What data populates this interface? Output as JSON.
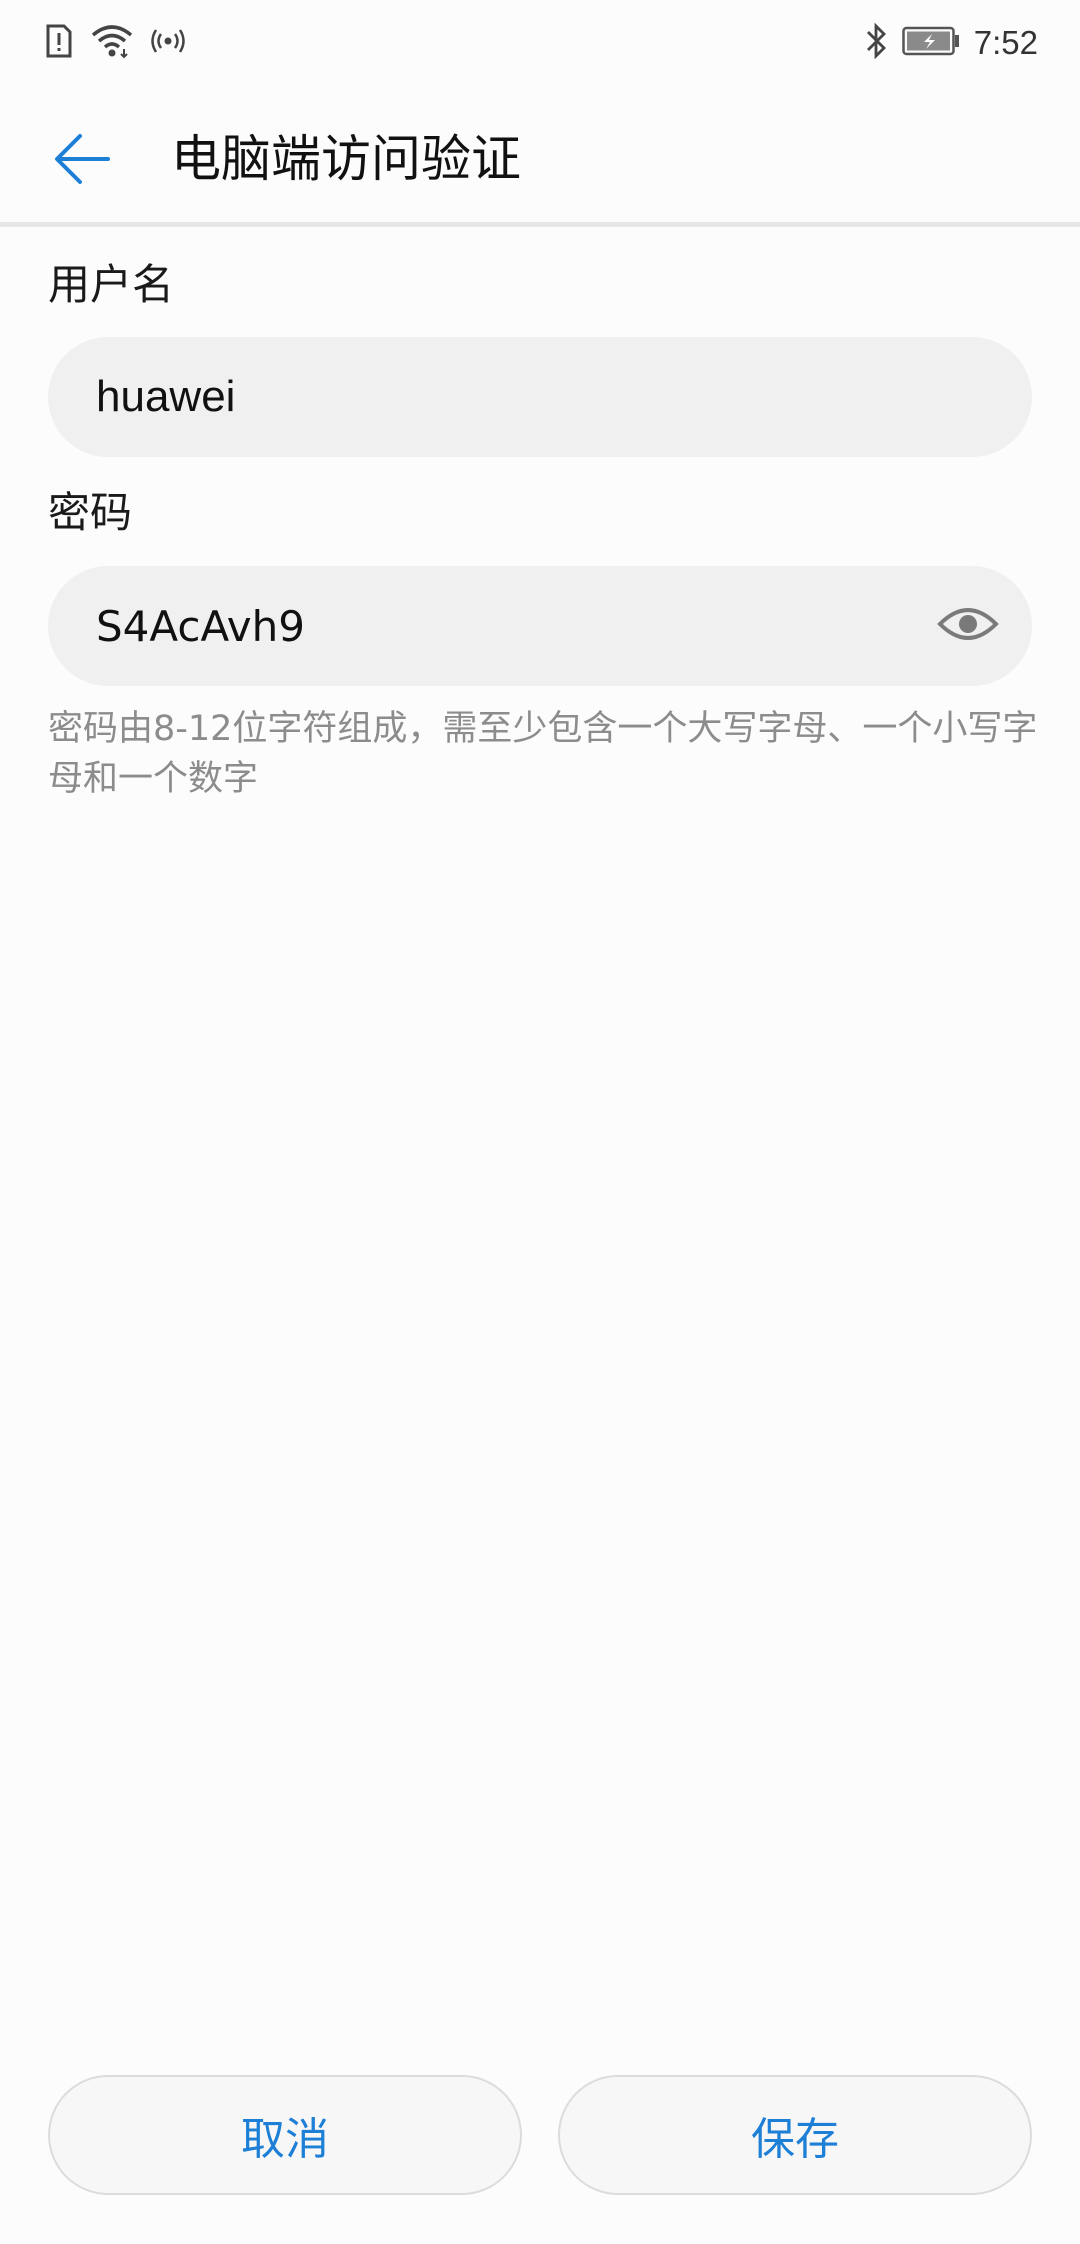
{
  "status_bar": {
    "time": "7:52",
    "left_icons": [
      "sim-alert-icon",
      "wifi-icon",
      "hotspot-icon"
    ],
    "right_icons": [
      "bluetooth-icon",
      "battery-charging-icon"
    ]
  },
  "app_bar": {
    "title": "电脑端访问验证",
    "back_icon": "arrow-left-icon"
  },
  "form": {
    "username_label": "用户名",
    "username_value": "huawei",
    "password_label": "密码",
    "password_value": "S4AcAvh9",
    "password_toggle_icon": "eye-icon",
    "hint": "密码由8-12位字符组成，需至少包含一个大写字母、一个小写字母和一个数字"
  },
  "actions": {
    "cancel_label": "取消",
    "save_label": "保存"
  },
  "colors": {
    "accent": "#1e7fd6",
    "field_bg": "#f0f0f0",
    "hint_text": "#8c8c8c"
  }
}
